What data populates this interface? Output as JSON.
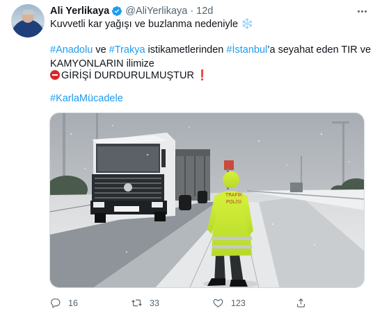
{
  "author": {
    "name": "Ali Yerlikaya",
    "handle": "@AliYerlikaya",
    "separator": "·",
    "time": "12d"
  },
  "tweet": {
    "line1_text": "Kuvvetli kar yağışı ve buzlanma nedeniyle",
    "line1_emoji": "❄️",
    "line2": {
      "tag1": "#Anadolu",
      "and": "ve",
      "tag2": "#Trakya",
      "mid": "istikametlerinden",
      "tag3": "#İstanbul",
      "tail": "’a seyahat eden TIR ve"
    },
    "line3": "KAMYONLARIN ilimize",
    "line4_text": "GİRİŞİ DURDURULMUŞTUR",
    "line4_bang": "❗",
    "hashtag": "#KarlaMücadele"
  },
  "media": {
    "sign_text_1": "TRAFİK",
    "sign_text_2": "POLİSİ"
  },
  "actions": {
    "reply_count": "16",
    "retweet_count": "33",
    "like_count": "123"
  },
  "colors": {
    "link": "#1d9bf0",
    "muted": "#536471",
    "verified": "#1d9bf0",
    "stop": "#d6292e"
  }
}
